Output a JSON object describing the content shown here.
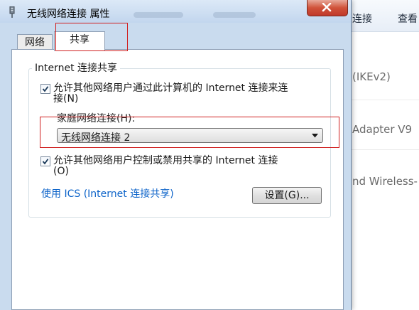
{
  "background": {
    "toolbar": {
      "item1": "连接",
      "item2": "查看"
    },
    "items": [
      "(IKEv2)",
      "Adapter V9",
      "nd Wireless-"
    ]
  },
  "dialog": {
    "title": "无线网络连接 属性",
    "tabs": [
      {
        "label": "网络"
      },
      {
        "label": "共享"
      }
    ],
    "group_title": "Internet 连接共享",
    "allow_sharing": {
      "checked": true,
      "line1": "允许其他网络用户通过此计算机的 Internet 连接来连",
      "line2": "接(N)"
    },
    "home_connection": {
      "label": "家庭网络连接(H):",
      "value": "无线网络连接 2"
    },
    "allow_control": {
      "checked": true,
      "line1": "允许其他网络用户控制或禁用共享的 Internet 连接",
      "line2": "(O)"
    },
    "ics_link": "使用 ICS (Internet 连接共享)",
    "settings_button": "设置(G)..."
  },
  "colors": {
    "highlight_box": "#d02020",
    "link": "#0c63c9",
    "dialog_frame": "#c9dbee"
  }
}
